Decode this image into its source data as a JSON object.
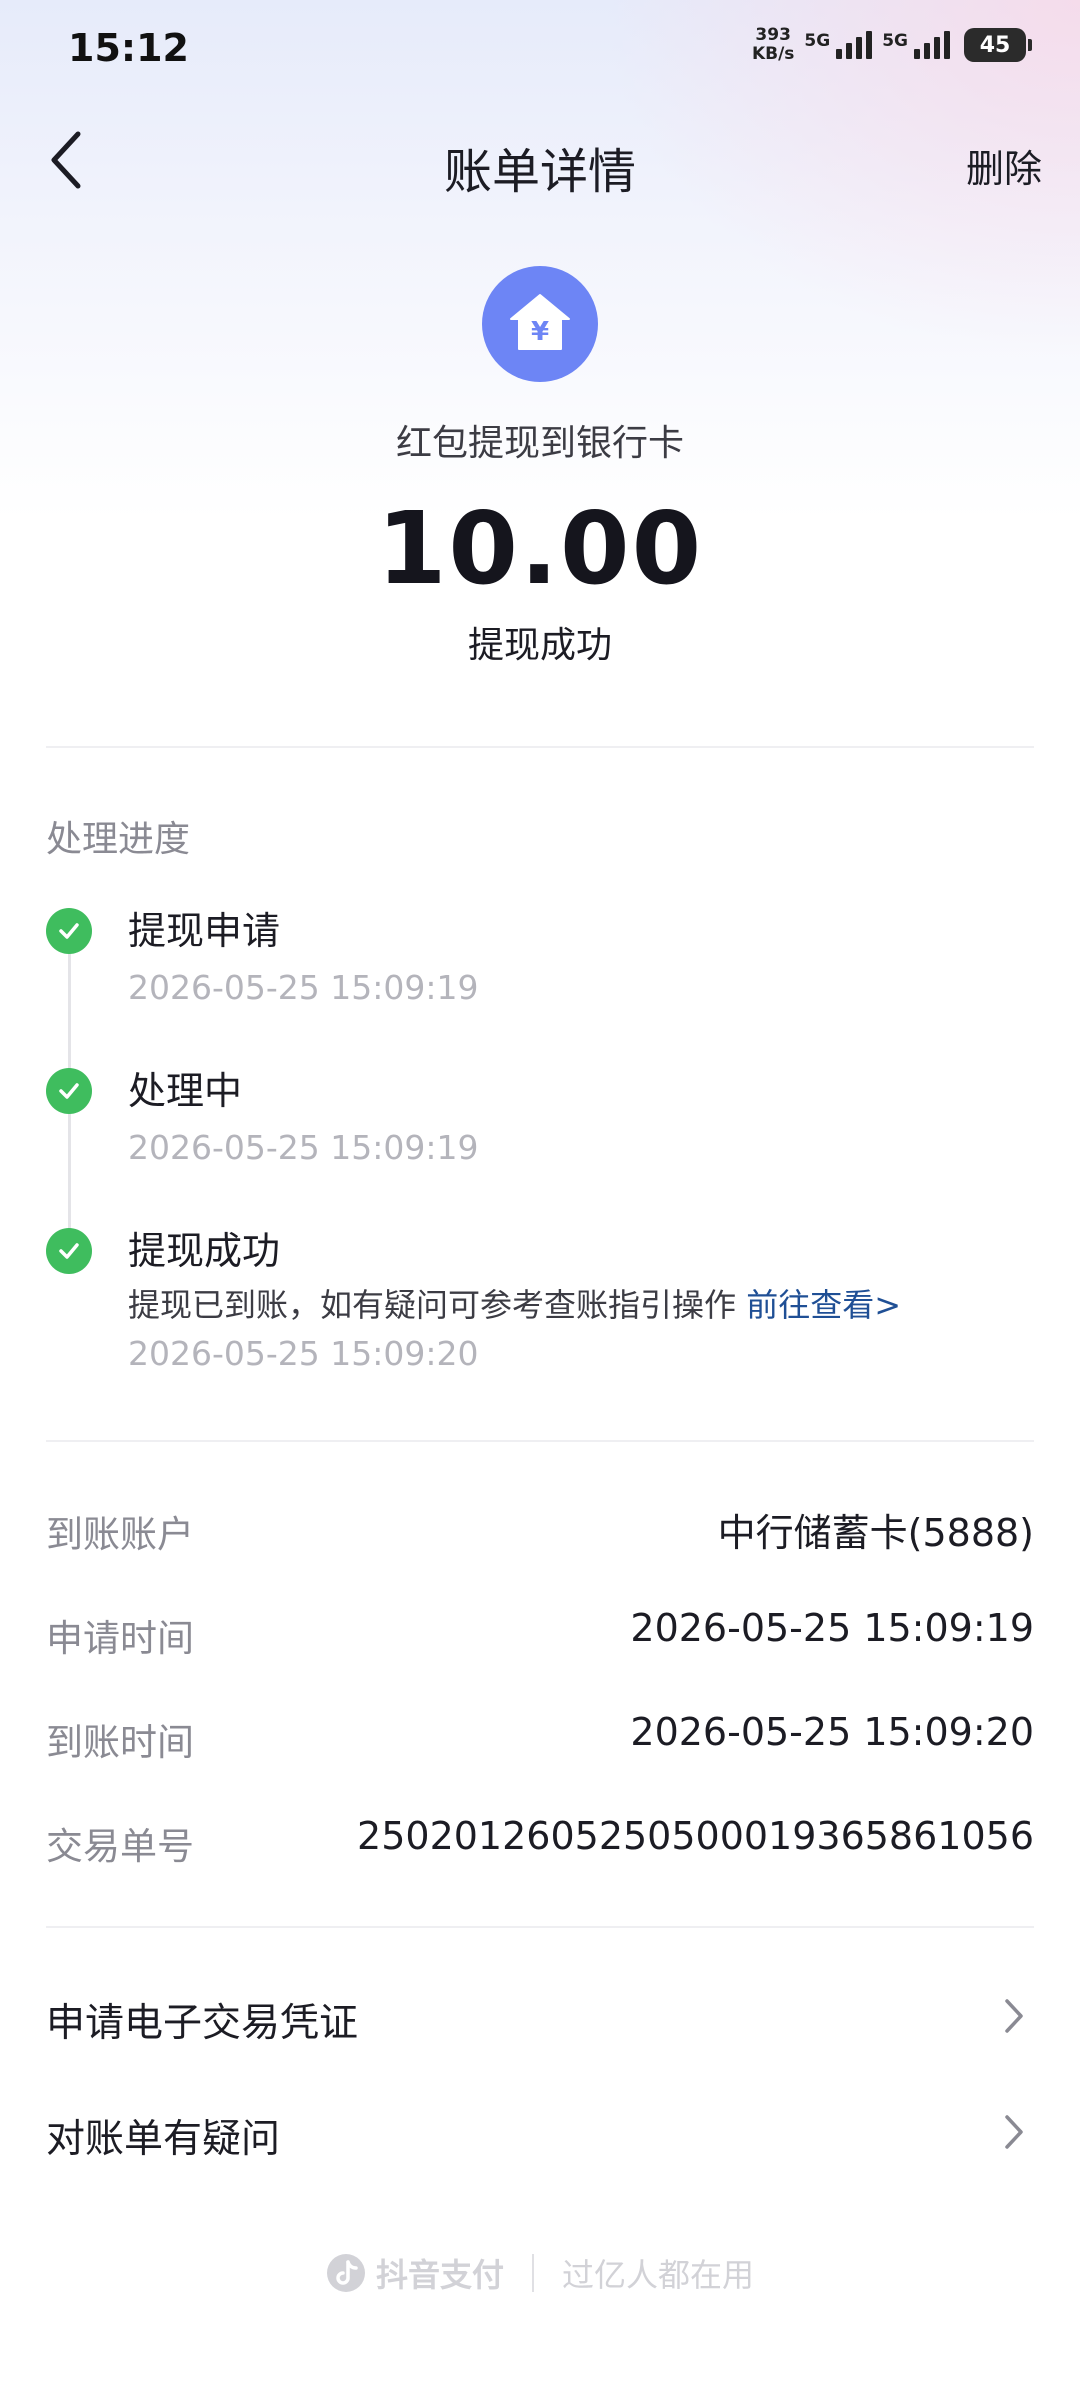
{
  "status_bar": {
    "time": "15:12",
    "net_speed_value": "393",
    "net_speed_unit": "KB/s",
    "signal1_label": "5G",
    "signal2_label": "5G",
    "battery": "45"
  },
  "nav": {
    "title": "账单详情",
    "delete_label": "删除"
  },
  "header": {
    "icon": "house-yen-icon",
    "icon_color": "#6d85f5",
    "subtitle": "红包提现到银行卡",
    "amount": "10.00",
    "status": "提现成功"
  },
  "progress": {
    "title": "处理进度",
    "steps": [
      {
        "title": "提现申请",
        "time": "2026-05-25 15:09:19"
      },
      {
        "title": "处理中",
        "time": "2026-05-25 15:09:19"
      },
      {
        "title": "提现成功",
        "desc": "提现已到账，如有疑问可参考查账指引操作",
        "link": "前往查看>",
        "time": "2026-05-25 15:09:20"
      }
    ],
    "check_color": "#3fbd5e"
  },
  "details": {
    "rows": [
      {
        "label": "到账账户",
        "value": "中行储蓄卡(5888)"
      },
      {
        "label": "申请时间",
        "value": "2026-05-25 15:09:19"
      },
      {
        "label": "到账时间",
        "value": "2026-05-25 15:09:20"
      },
      {
        "label": "交易单号",
        "value": "2502012605250500019365861056"
      }
    ]
  },
  "actions": [
    {
      "label": "申请电子交易凭证"
    },
    {
      "label": "对账单有疑问"
    }
  ],
  "footer": {
    "brand": "抖音支付",
    "slogan": "过亿人都在用"
  }
}
